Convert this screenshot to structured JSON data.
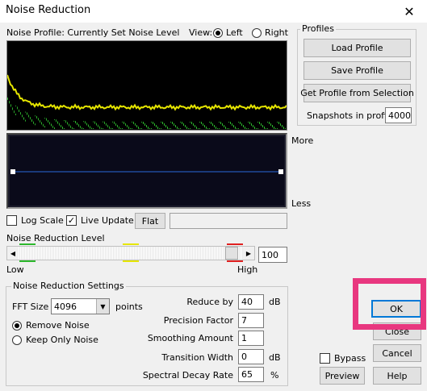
{
  "window": {
    "title": "Noise Reduction",
    "close_glyph": "✕"
  },
  "profile": {
    "label": "Noise Profile: Currently Set Noise Level",
    "view_label": "View:",
    "view_options": [
      "Left",
      "Right"
    ],
    "view_selected": "Left"
  },
  "curve_labels": {
    "more": "More",
    "less": "Less"
  },
  "options": {
    "log_scale": {
      "label": "Log Scale",
      "checked": false
    },
    "live_update": {
      "label": "Live Update",
      "checked": true
    },
    "flat_button": "Flat"
  },
  "reduction_level": {
    "label": "Noise Reduction Level",
    "low": "Low",
    "high": "High",
    "value": "100",
    "level": 1.0
  },
  "profiles_group": {
    "title": "Profiles",
    "load": "Load Profile",
    "save": "Save Profile",
    "get_from_selection": "Get Profile from Selection",
    "snapshots_label": "Snapshots in profile",
    "snapshots_value": "4000"
  },
  "settings": {
    "title": "Noise Reduction Settings",
    "fft_label": "FFT Size",
    "fft_value": "4096",
    "fft_unit": "points",
    "remove_noise": "Remove Noise",
    "keep_only_noise": "Keep Only Noise",
    "mode_selected": "Remove Noise",
    "reduce_by_label": "Reduce by",
    "reduce_by_value": "40",
    "reduce_by_unit": "dB",
    "precision_label": "Precision Factor",
    "precision_value": "7",
    "smoothing_label": "Smoothing Amount",
    "smoothing_value": "1",
    "transition_label": "Transition Width",
    "transition_value": "0",
    "transition_unit": "dB",
    "decay_label": "Spectral Decay Rate",
    "decay_value": "65",
    "decay_unit": "%"
  },
  "actions": {
    "ok": "OK",
    "close": "Close",
    "cancel": "Cancel",
    "bypass": "Bypass",
    "preview": "Preview",
    "help": "Help"
  },
  "colors": {
    "profile_peak": "#e6e600",
    "profile_floor": "#2db82d",
    "curve": "#2a6bdc",
    "curve_bg": "#0a0a1a",
    "highlight": "#e8377f",
    "default_button": "#0078d7"
  }
}
